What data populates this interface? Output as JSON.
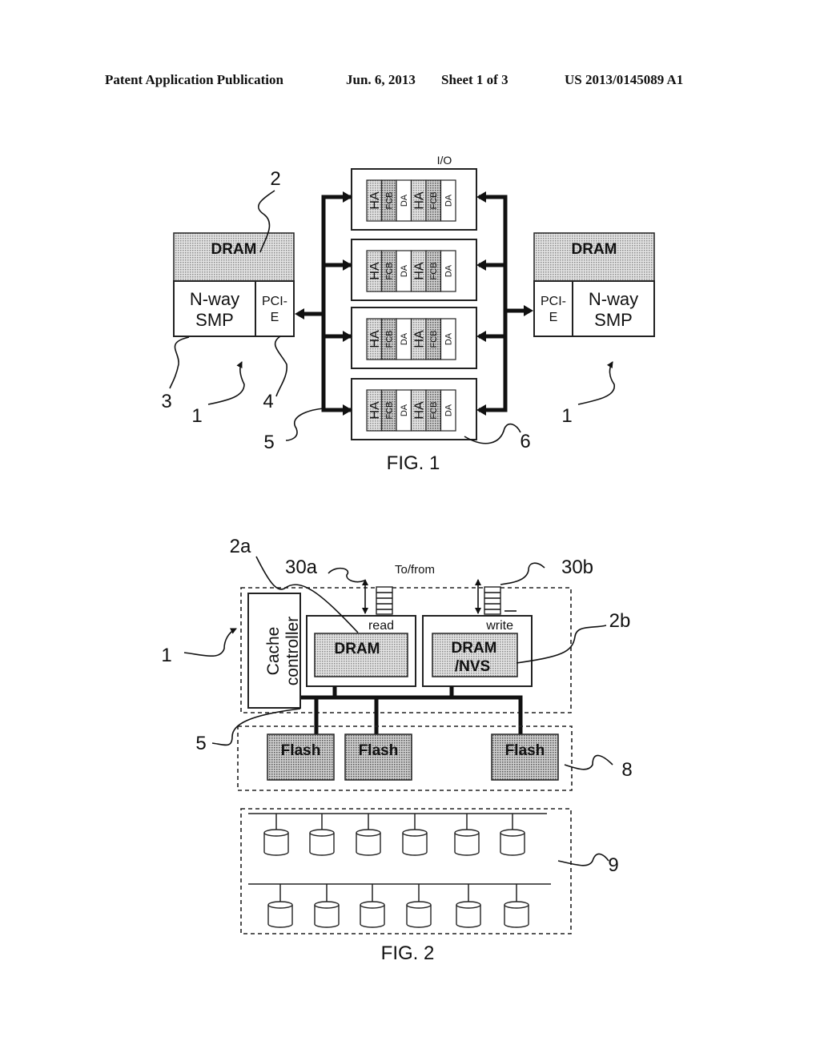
{
  "header": {
    "publication": "Patent Application Publication",
    "date": "Jun. 6, 2013",
    "sheet": "Sheet 1 of 3",
    "number": "US 2013/0145089 A1"
  },
  "fig1": {
    "caption": "FIG. 1",
    "io_label": "I/O",
    "left_node": {
      "dram": "DRAM",
      "smp_line1": "N-way",
      "smp_line2": "SMP",
      "pci_line1": "PCI-",
      "pci_line2": "E"
    },
    "right_node": {
      "dram": "DRAM",
      "smp_line1": "N-way",
      "smp_line2": "SMP",
      "pci_line1": "PCI-",
      "pci_line2": "E"
    },
    "adapter_cells": [
      "HA",
      "FCB",
      "DA",
      "HA",
      "FCB",
      "DA"
    ],
    "refs": {
      "r2": "2",
      "r3": "3",
      "r1a": "1",
      "r4": "4",
      "r5": "5",
      "r6": "6",
      "r1b": "1"
    }
  },
  "fig2": {
    "caption": "FIG. 2",
    "to_from": "To/from",
    "cache_line1": "Cache",
    "cache_line2": "controller",
    "read_label": "read",
    "write_label": "write",
    "dram_read": "DRAM",
    "dram_write_line1": "DRAM",
    "dram_write_line2": "/NVS",
    "flash": [
      "Flash",
      "Flash",
      "Flash"
    ],
    "refs": {
      "r2a": "2a",
      "r30a": "30a",
      "r30b": "30b",
      "r2b": "2b",
      "r1": "1",
      "r5": "5",
      "r8": "8",
      "r9": "9"
    }
  },
  "colors": {
    "ink": "#111111",
    "shade": "#c8c8c8"
  }
}
